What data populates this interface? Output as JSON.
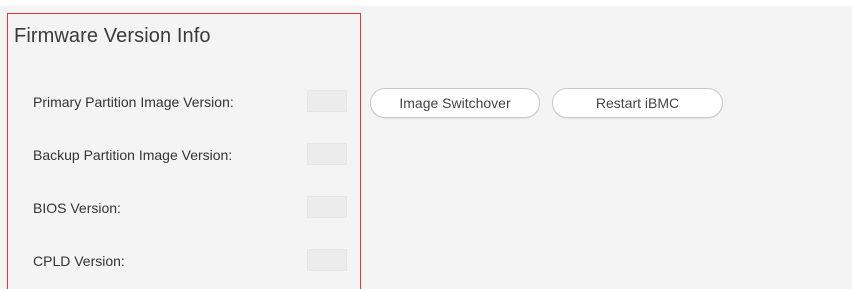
{
  "section": {
    "title": "Firmware Version Info"
  },
  "rows": [
    {
      "label": "Primary Partition Image Version:",
      "value": ""
    },
    {
      "label": "Backup Partition Image Version:",
      "value": ""
    },
    {
      "label": "BIOS Version:",
      "value": ""
    },
    {
      "label": "CPLD Version:",
      "value": ""
    }
  ],
  "buttons": {
    "image_switchover": "Image Switchover",
    "restart_ibmc": "Restart iBMC"
  },
  "colors": {
    "highlight_border": "#e8333a",
    "background": "#f4f4f4",
    "value_placeholder": "#ececec"
  }
}
